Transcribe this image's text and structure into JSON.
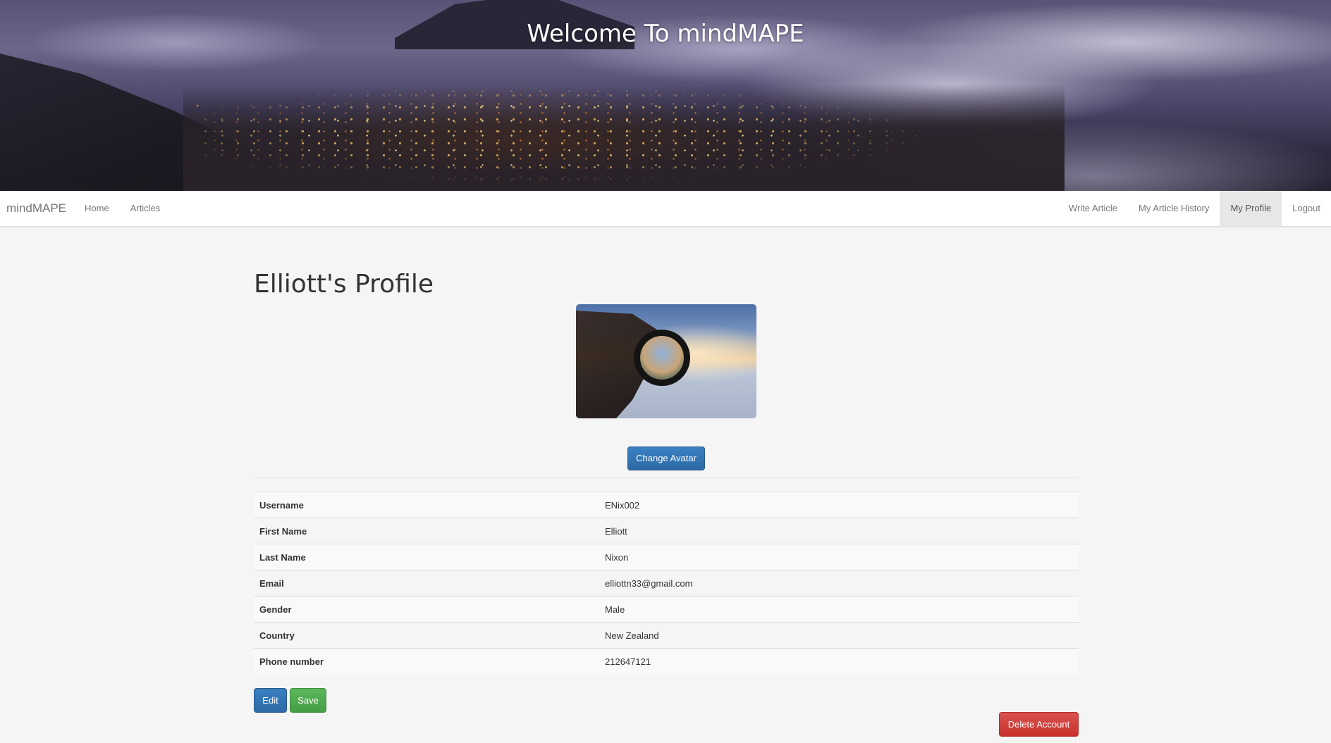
{
  "hero": {
    "title": "Welcome To mindMAPE"
  },
  "navbar": {
    "brand": "mindMAPE",
    "left_items": [
      {
        "label": "Home"
      },
      {
        "label": "Articles"
      }
    ],
    "right_items": [
      {
        "label": "Write Article",
        "active": false
      },
      {
        "label": "My Article History",
        "active": false
      },
      {
        "label": "My Profile",
        "active": true
      },
      {
        "label": "Logout",
        "active": false
      }
    ]
  },
  "profile": {
    "title": "Elliott's Profile",
    "change_avatar_label": "Change Avatar",
    "fields": [
      {
        "label": "Username",
        "value": "ENix002"
      },
      {
        "label": "First Name",
        "value": "Elliott"
      },
      {
        "label": "Last Name",
        "value": "Nixon"
      },
      {
        "label": "Email",
        "value": "elliottn33@gmail.com"
      },
      {
        "label": "Gender",
        "value": "Male"
      },
      {
        "label": "Country",
        "value": "New Zealand"
      },
      {
        "label": "Phone number",
        "value": "212647121"
      }
    ],
    "edit_label": "Edit",
    "save_label": "Save",
    "delete_label": "Delete Account"
  },
  "colors": {
    "primary": "#2d6aa6",
    "success": "#449d44",
    "danger": "#c9302c",
    "nav_active_bg": "#e7e7e7"
  }
}
